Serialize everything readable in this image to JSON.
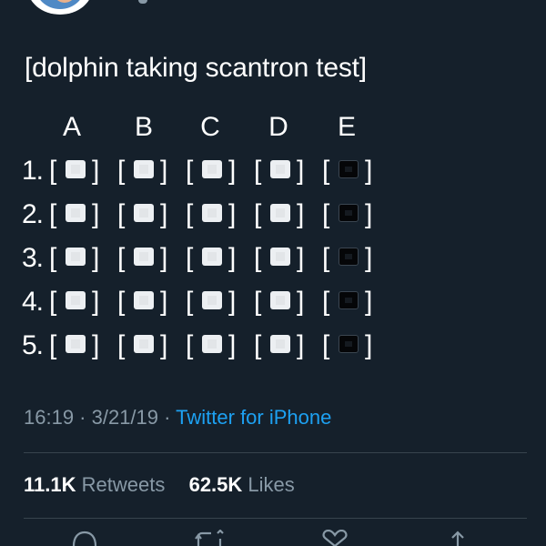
{
  "tweet": {
    "text": "[dolphin taking scantron test]",
    "timestamp": "16:19 · 3/21/19 · ",
    "source": "Twitter for iPhone"
  },
  "scantron": {
    "choices": [
      "A",
      "B",
      "C",
      "D",
      "E"
    ],
    "bracket_left": "[",
    "bracket_right": "]",
    "rows": [
      {
        "number": "1.",
        "marks": [
          "white",
          "white",
          "white",
          "white",
          "black"
        ]
      },
      {
        "number": "2.",
        "marks": [
          "white",
          "white",
          "white",
          "white",
          "black"
        ]
      },
      {
        "number": "3.",
        "marks": [
          "white",
          "white",
          "white",
          "white",
          "black"
        ]
      },
      {
        "number": "4.",
        "marks": [
          "white",
          "white",
          "white",
          "white",
          "black"
        ]
      },
      {
        "number": "5.",
        "marks": [
          "white",
          "white",
          "white",
          "white",
          "black"
        ]
      }
    ]
  },
  "stats": {
    "retweets_count": "11.1K",
    "retweets_label": " Retweets",
    "likes_count": "62.5K",
    "likes_label": " Likes"
  },
  "actions": [
    {
      "name": "reply-icon"
    },
    {
      "name": "retweet-icon"
    },
    {
      "name": "like-icon"
    },
    {
      "name": "share-icon"
    }
  ],
  "colors": {
    "background": "#15202b",
    "link": "#1da1f2",
    "muted": "#8899a6"
  }
}
